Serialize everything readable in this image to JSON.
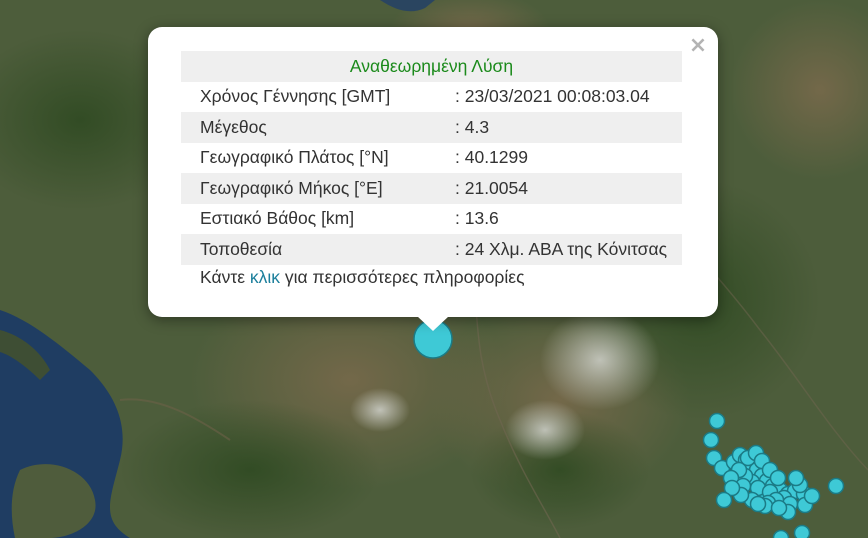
{
  "popup": {
    "title": "Αναθεωρημένη Λύση",
    "close_icon": "close-icon",
    "rows": [
      {
        "label": "Χρόνος Γέννησης [GMT]",
        "value": ": 23/03/2021 00:08:03.04"
      },
      {
        "label": "Μέγεθος",
        "value": ": 4.3"
      },
      {
        "label": "Γεωγραφικό Πλάτος [°N]",
        "value": ": 40.1299"
      },
      {
        "label": "Γεωγραφικό Μήκος [°E]",
        "value": ": 21.0054"
      },
      {
        "label": "Εστιακό Βάθος [km]",
        "value": ": 13.6"
      },
      {
        "label": "Τοποθεσία",
        "value": ": 24 Χλμ. ΑΒΑ της Κόνιτσας"
      }
    ],
    "more_prefix": "Κάντε ",
    "more_link": "κλικ",
    "more_suffix": " για περισσότερες πληροφορίες"
  },
  "map": {
    "marker_color": "#3ec9d6",
    "marker_stroke": "#1b7b86"
  }
}
